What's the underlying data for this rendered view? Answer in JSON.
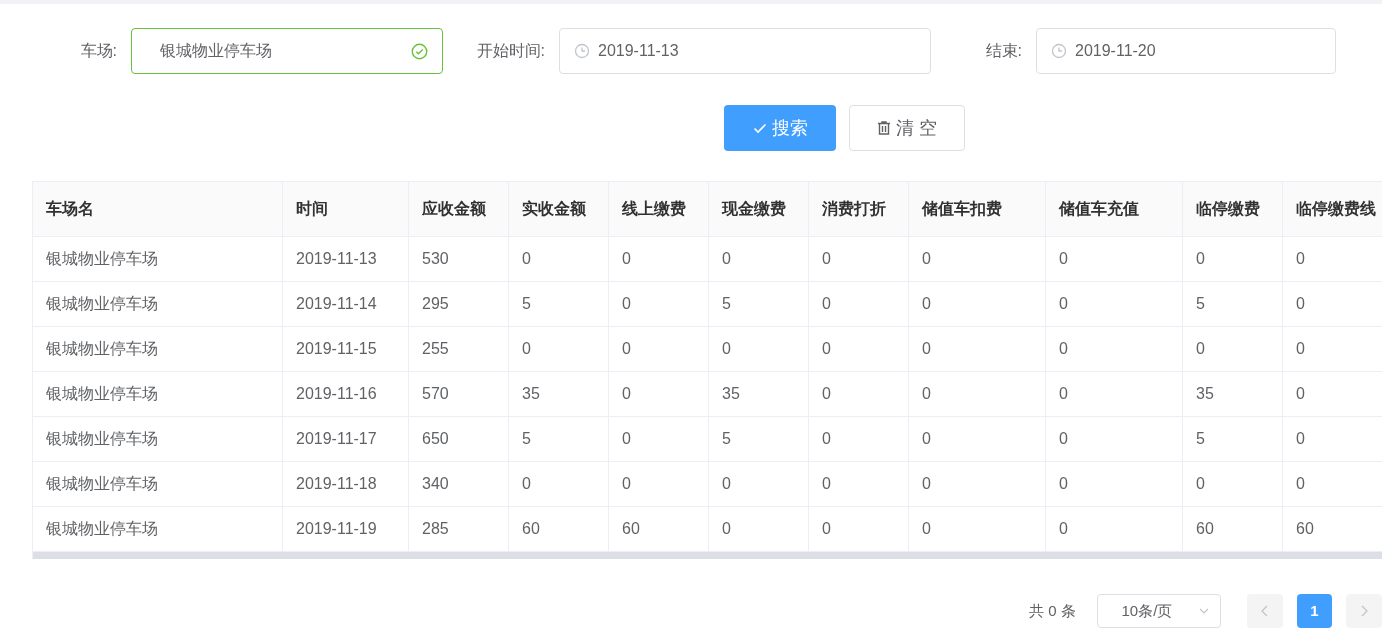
{
  "filters": [
    {
      "kind": "text",
      "label": "车场:",
      "value": "银城物业停车场",
      "valid": true
    },
    {
      "kind": "date",
      "label": "开始时间:",
      "value": "2019-11-13"
    },
    {
      "kind": "date",
      "label": "结束:",
      "value": "2019-11-20"
    }
  ],
  "buttons": [
    {
      "kind": "primary",
      "label": "搜索"
    },
    {
      "kind": "default",
      "label": "清 空"
    }
  ],
  "table": {
    "columns": [
      "车场名",
      "时间",
      "应收金额",
      "实收金额",
      "线上缴费",
      "现金缴费",
      "消费打折",
      "储值车扣费",
      "储值车充值",
      "临停缴费",
      "临停缴费线"
    ],
    "rows": [
      [
        "银城物业停车场",
        "2019-11-13",
        "530",
        "0",
        "0",
        "0",
        "0",
        "0",
        "0",
        "0",
        "0"
      ],
      [
        "银城物业停车场",
        "2019-11-14",
        "295",
        "5",
        "0",
        "5",
        "0",
        "0",
        "0",
        "5",
        "0"
      ],
      [
        "银城物业停车场",
        "2019-11-15",
        "255",
        "0",
        "0",
        "0",
        "0",
        "0",
        "0",
        "0",
        "0"
      ],
      [
        "银城物业停车场",
        "2019-11-16",
        "570",
        "35",
        "0",
        "35",
        "0",
        "0",
        "0",
        "35",
        "0"
      ],
      [
        "银城物业停车场",
        "2019-11-17",
        "650",
        "5",
        "0",
        "5",
        "0",
        "0",
        "0",
        "5",
        "0"
      ],
      [
        "银城物业停车场",
        "2019-11-18",
        "340",
        "0",
        "0",
        "0",
        "0",
        "0",
        "0",
        "0",
        "0"
      ],
      [
        "银城物业停车场",
        "2019-11-19",
        "285",
        "60",
        "60",
        "0",
        "0",
        "0",
        "0",
        "60",
        "60"
      ]
    ]
  },
  "pagination": {
    "total": "共 0 条",
    "page_size": "10条/页",
    "prev_disabled": true,
    "next_disabled": true,
    "pages": [
      {
        "label": "1",
        "selected": true
      }
    ]
  }
}
